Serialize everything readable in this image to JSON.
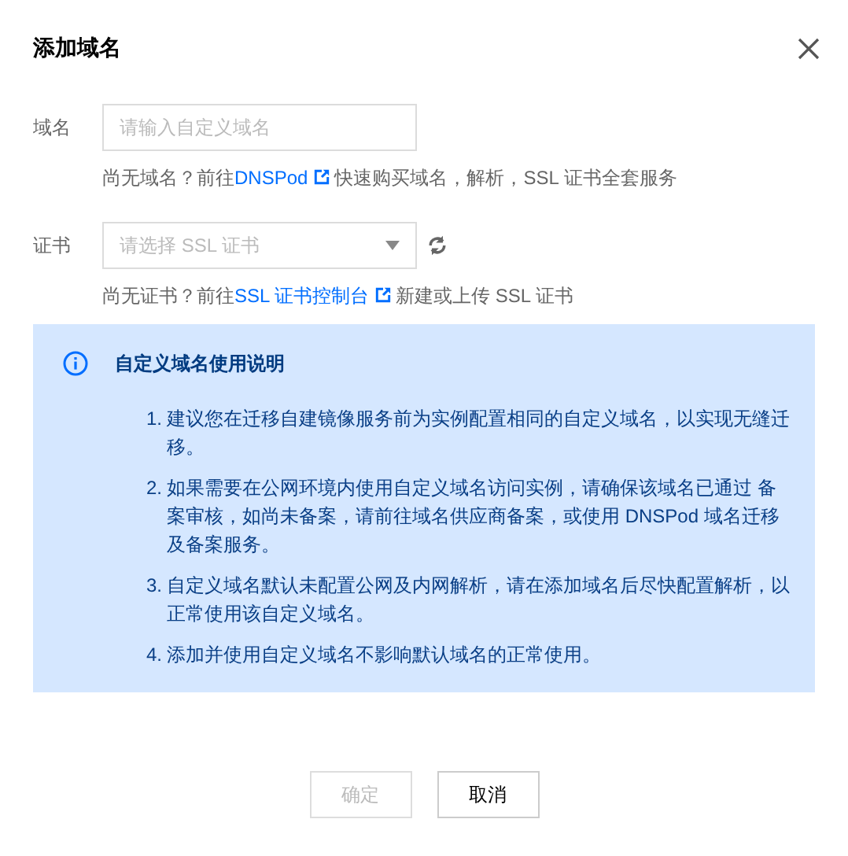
{
  "dialog": {
    "title": "添加域名"
  },
  "fields": [
    {
      "kind": "input",
      "label": "域名",
      "placeholder": "请输入自定义域名",
      "hint": {
        "before": "尚无域名？前往",
        "link": "DNSPod",
        "after": "快速购买域名，解析，SSL 证书全套服务"
      }
    },
    {
      "kind": "select",
      "label": "证书",
      "placeholder": "请选择 SSL 证书",
      "hint": {
        "before": "尚无证书？前往",
        "link": "SSL 证书控制台",
        "after": "新建或上传 SSL 证书"
      }
    }
  ],
  "notice": {
    "title": "自定义域名使用说明",
    "items": [
      {
        "number": "1.",
        "text": "建议您在迁移自建镜像服务前为实例配置相同的自定义域名，以实现无缝迁移。"
      },
      {
        "number": "2.",
        "text": "如果需要在公网环境内使用自定义域名访问实例，请确保该域名已通过 备案审核，如尚未备案，请前往域名供应商备案，或使用 DNSPod 域名迁移及备案服务。"
      },
      {
        "number": "3.",
        "text": "自定义域名默认未配置公网及内网解析，请在添加域名后尽快配置解析，以正常使用该自定义域名。"
      },
      {
        "number": "4.",
        "text": "添加并使用自定义域名不影响默认域名的正常使用。"
      }
    ]
  },
  "buttons": [
    {
      "label": "确定",
      "disabled": true
    },
    {
      "label": "取消",
      "disabled": false
    }
  ]
}
